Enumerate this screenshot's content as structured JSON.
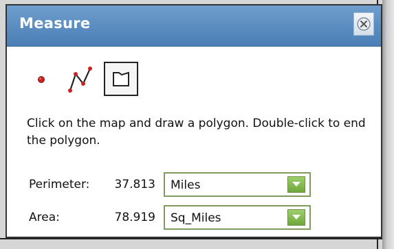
{
  "window": {
    "title": "Measure",
    "close_icon": "close-circle-x-icon"
  },
  "tools": [
    {
      "name": "point",
      "icon": "point-icon",
      "color": "#cc2222"
    },
    {
      "name": "distance",
      "icon": "polyline-icon",
      "color": "#cc2222"
    },
    {
      "name": "area",
      "icon": "polygon-icon",
      "selected": true
    }
  ],
  "instructions": "Click on the map and draw a polygon. Double-click to end the polygon.",
  "results": {
    "perimeter": {
      "label": "Perimeter:",
      "value": "37.813",
      "unit": "Miles"
    },
    "area": {
      "label": "Area:",
      "value": "78.919",
      "unit": "Sq_Miles"
    }
  },
  "colors": {
    "titlebar": "#5a8cc0",
    "dropdown_border": "#7f9a5a",
    "dropdown_button": "#7fb84a"
  }
}
